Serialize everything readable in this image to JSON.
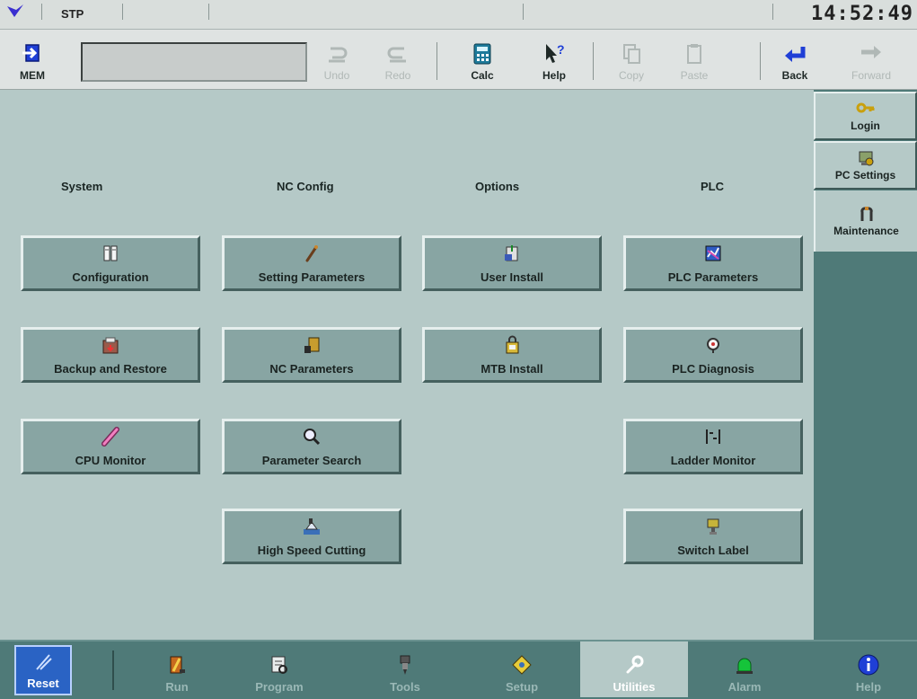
{
  "status": {
    "mode": "STP",
    "time": "14:52:49"
  },
  "toolbar": {
    "mem": "MEM",
    "undo": "Undo",
    "redo": "Redo",
    "calc": "Calc",
    "help": "Help",
    "copy": "Copy",
    "paste": "Paste",
    "back": "Back",
    "forward": "Forward"
  },
  "columns": {
    "system": "System",
    "nc_config": "NC Config",
    "options": "Options",
    "plc": "PLC"
  },
  "buttons": {
    "configuration": "Configuration",
    "backup_restore": "Backup and Restore",
    "cpu_monitor": "CPU Monitor",
    "setting_parameters": "Setting Parameters",
    "nc_parameters": "NC Parameters",
    "parameter_search": "Parameter Search",
    "high_speed_cutting": "High Speed Cutting",
    "user_install": "User Install",
    "mtb_install": "MTB Install",
    "plc_parameters": "PLC Parameters",
    "plc_diagnosis": "PLC Diagnosis",
    "ladder_monitor": "Ladder Monitor",
    "switch_label": "Switch Label"
  },
  "sidebar": {
    "login": "Login",
    "pc_settings": "PC Settings",
    "maintenance": "Maintenance"
  },
  "bottom": {
    "reset": "Reset",
    "run": "Run",
    "program": "Program",
    "tools": "Tools",
    "setup": "Setup",
    "utilities": "Utilities",
    "alarm": "Alarm",
    "help": "Help"
  },
  "colors": {
    "panel": "#b5c9c7",
    "button": "#88a5a3",
    "frame": "#4f7a78",
    "reset": "#2a63c4"
  }
}
